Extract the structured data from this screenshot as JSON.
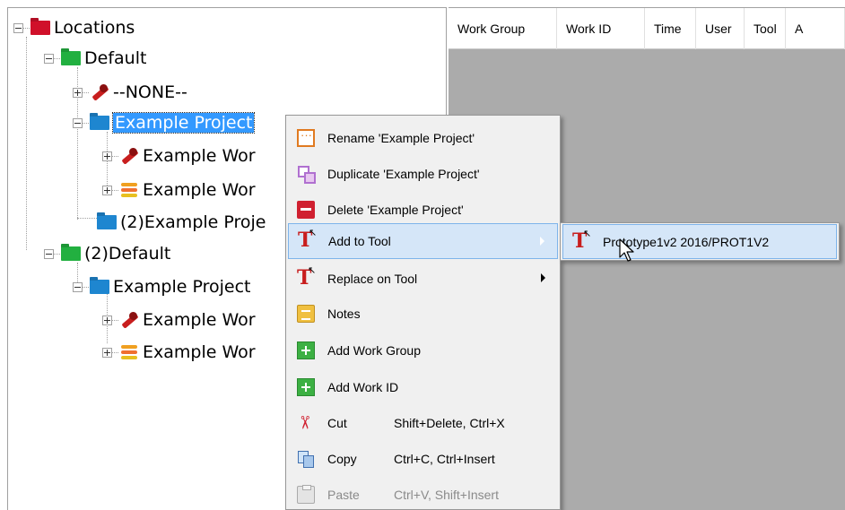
{
  "tree": {
    "items": [
      {
        "label": "Locations",
        "icon": "folder-red-icon"
      },
      {
        "label": "Default",
        "icon": "folder-green-icon"
      },
      {
        "label": "--NONE--",
        "icon": "wrench-icon"
      },
      {
        "label": "Example Project",
        "icon": "folder-blue-icon"
      },
      {
        "label": "Example Wor",
        "icon": "wrench-icon"
      },
      {
        "label": "Example Wor",
        "icon": "stack-icon"
      },
      {
        "label": "(2)Example Proje",
        "icon": "folder-blue-icon"
      },
      {
        "label": "(2)Default",
        "icon": "folder-green-icon"
      },
      {
        "label": "Example Project",
        "icon": "folder-blue-icon"
      },
      {
        "label": "Example Wor",
        "icon": "wrench-icon"
      },
      {
        "label": "Example Wor",
        "icon": "stack-icon"
      }
    ]
  },
  "grid": {
    "columns": [
      "Work Group",
      "Work ID",
      "Time",
      "User",
      "Tool",
      "A"
    ]
  },
  "context_menu": {
    "items": [
      {
        "label": "Rename 'Example Project'",
        "icon": "rename-icon"
      },
      {
        "label": "Duplicate 'Example Project'",
        "icon": "duplicate-icon"
      },
      {
        "label": "Delete 'Example Project'",
        "icon": "delete-icon"
      },
      {
        "label": "Add to Tool",
        "icon": "tool-icon",
        "submenu": true,
        "highlighted": true
      },
      {
        "label": "Replace on Tool",
        "icon": "tool-icon",
        "submenu": true
      },
      {
        "label": "Notes",
        "icon": "notes-icon"
      },
      {
        "label": "Add Work Group",
        "icon": "add-icon"
      },
      {
        "label": "Add Work ID",
        "icon": "add-icon"
      },
      {
        "label": "Cut",
        "icon": "cut-icon",
        "shortcut": "Shift+Delete, Ctrl+X"
      },
      {
        "label": "Copy",
        "icon": "copy-icon",
        "shortcut": "Ctrl+C, Ctrl+Insert"
      },
      {
        "label": "Paste",
        "icon": "paste-icon",
        "shortcut": "Ctrl+V, Shift+Insert",
        "disabled": true
      }
    ]
  },
  "submenu": {
    "items": [
      {
        "label": "Prototype1v2 2016/PROT1V2",
        "icon": "tool-icon"
      }
    ]
  },
  "colors": {
    "selection": "#3399ff",
    "menu_highlight": "#d5e6f8",
    "menu_highlight_border": "#7eb4ea",
    "grid_background": "#ababab"
  }
}
